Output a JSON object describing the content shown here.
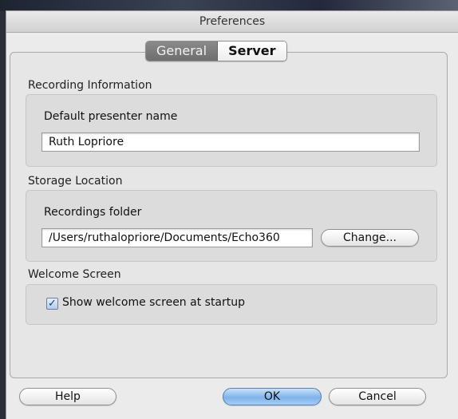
{
  "window": {
    "title": "Preferences"
  },
  "tabs": [
    {
      "label": "General",
      "selected": true
    },
    {
      "label": "Server",
      "selected": false
    }
  ],
  "recording_information": {
    "section_title": "Recording Information",
    "presenter_label": "Default presenter name",
    "presenter_value": "Ruth Lopriore"
  },
  "storage_location": {
    "section_title": "Storage Location",
    "folder_label": "Recordings folder",
    "folder_value": "/Users/ruthalopriore/Documents/Echo360",
    "change_button": "Change..."
  },
  "welcome_screen": {
    "section_title": "Welcome Screen",
    "checkbox_label": "Show welcome screen at startup",
    "checked": true
  },
  "footer": {
    "help_button": "Help",
    "ok_button": "OK",
    "cancel_button": "Cancel"
  },
  "colors": {
    "window_bg": "#ebebeb",
    "default_button": "#7fb3ea"
  }
}
